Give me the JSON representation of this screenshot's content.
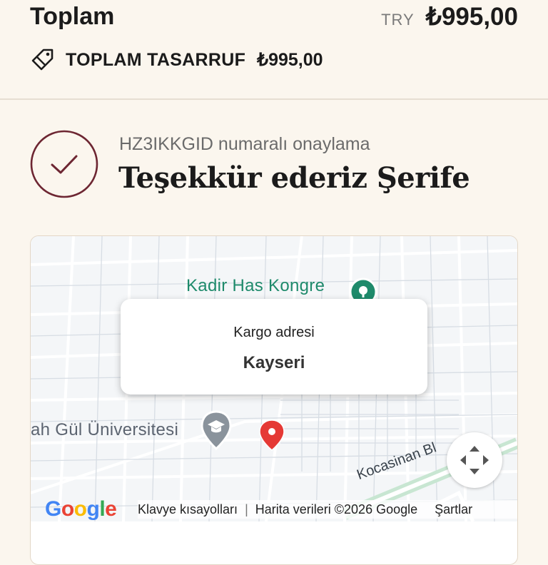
{
  "summary": {
    "total_label": "Toplam",
    "currency": "TRY",
    "total_amount": "₺995,00",
    "savings_label": "TOPLAM TASARRUF",
    "savings_amount": "₺995,00"
  },
  "confirmation": {
    "number_text": "HZ3IKKGID numaralı onaylama",
    "thanks_heading": "Teşekkür ederiz Şerife"
  },
  "map": {
    "poi_top": "Kadir Has Kongre",
    "poi_university": "ah Gül Üniversitesi",
    "street": "Kocasinan Bl",
    "popup_title": "Kargo adresi",
    "popup_city": "Kayseri",
    "logo_letters": [
      "G",
      "o",
      "o",
      "g",
      "l",
      "e"
    ],
    "logo_colors": [
      "#4285F4",
      "#EA4335",
      "#FBBC05",
      "#4285F4",
      "#34A853",
      "#EA4335"
    ],
    "keyboard_shortcuts": "Klavye kısayolları",
    "map_data": "Harita verileri ©2026 Google",
    "terms": "Şartlar"
  },
  "colors": {
    "background": "#fbf6ee",
    "accent": "#6d2632",
    "poi_green": "#1e8a6b",
    "pin_red": "#e53935"
  }
}
